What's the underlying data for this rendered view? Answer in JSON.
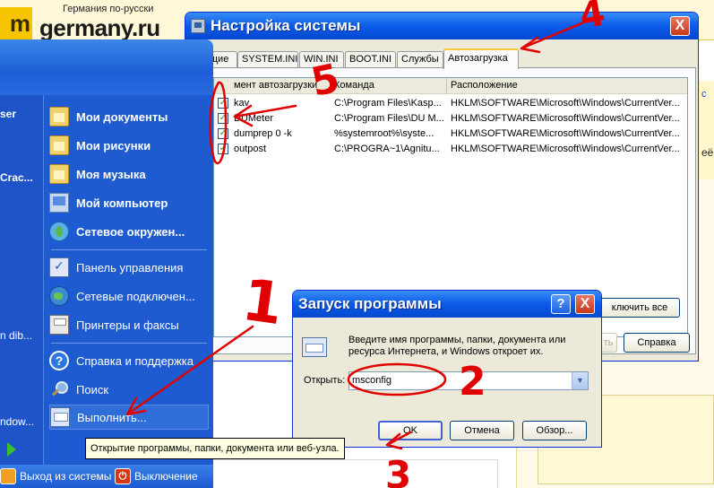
{
  "website": {
    "logo_left_fragment": "m",
    "logo_caption": "Германия по-русски",
    "logo_name": "germany.ru",
    "right_fragment_1": "с",
    "right_fragment_2": "её"
  },
  "start_menu": {
    "left_column_fragments": [
      "ser",
      "Crac...",
      "n dib...",
      "ndow..."
    ],
    "items": [
      {
        "label": "Мои документы",
        "icon": "my-documents-icon"
      },
      {
        "label": "Мои рисунки",
        "icon": "my-pictures-icon"
      },
      {
        "label": "Моя музыка",
        "icon": "my-music-icon"
      },
      {
        "label": "Мой компьютер",
        "icon": "my-computer-icon"
      },
      {
        "label": "Сетевое окружен...",
        "icon": "network-places-icon"
      },
      {
        "label": "Панель управления",
        "icon": "control-panel-icon"
      },
      {
        "label": "Сетевые подключен...",
        "icon": "network-connections-icon"
      },
      {
        "label": "Принтеры и факсы",
        "icon": "printers-icon"
      },
      {
        "label": "Справка и поддержка",
        "icon": "help-icon"
      },
      {
        "label": "Поиск",
        "icon": "search-icon"
      },
      {
        "label": "Выполнить...",
        "icon": "run-icon"
      }
    ],
    "logoff_label": "Выход из системы",
    "shutdown_label": "Выключение"
  },
  "tooltip": "Открытие программы, папки, документа или веб-узла.",
  "sysconfig": {
    "title": "Настройка системы",
    "close_glyph": "X",
    "tabs": [
      "щие",
      "SYSTEM.INI",
      "WIN.INI",
      "BOOT.INI",
      "Службы",
      "Автозагрузка"
    ],
    "active_tab": "Автозагрузка",
    "columns": [
      "мент автозагрузки",
      "Команда",
      "Расположение"
    ],
    "rows": [
      {
        "item": "kav",
        "command": "C:\\Program Files\\Kasp...",
        "location": "HKLM\\SOFTWARE\\Microsoft\\Windows\\CurrentVer..."
      },
      {
        "item": "DUMeter",
        "command": "C:\\Program Files\\DU M...",
        "location": "HKLM\\SOFTWARE\\Microsoft\\Windows\\CurrentVer..."
      },
      {
        "item": "dumprep 0 -k",
        "command": "%systemroot%\\syste...",
        "location": "HKLM\\SOFTWARE\\Microsoft\\Windows\\CurrentVer..."
      },
      {
        "item": "outpost",
        "command": "C:\\PROGRA~1\\Agnitu...",
        "location": "HKLM\\SOFTWARE\\Microsoft\\Windows\\CurrentVer..."
      }
    ],
    "disable_all_label": "ключить все",
    "apply_fragment": "ть",
    "help_label": "Справка"
  },
  "run_dialog": {
    "title": "Запуск программы",
    "help_glyph": "?",
    "close_glyph": "X",
    "description": "Введите имя программы, папки, документа или ресурса Интернета, и Windows откроет их.",
    "open_label": "Открыть:",
    "input_value": "msconfig",
    "ok_label": "OK",
    "cancel_label": "Отмена",
    "browse_label": "Обзор..."
  },
  "annotations": {
    "labels": [
      "1",
      "2",
      "3",
      "4",
      "5"
    ],
    "color": "#e00000"
  }
}
